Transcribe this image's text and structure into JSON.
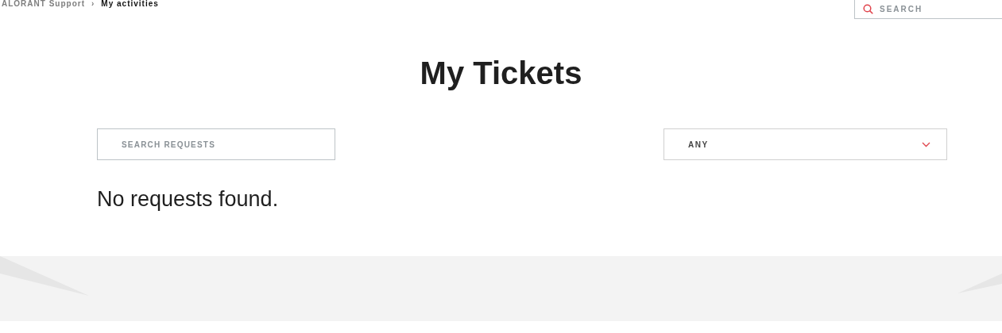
{
  "breadcrumb": [
    {
      "label": "ALORANT Support",
      "current": false
    },
    {
      "label": "My activities",
      "current": true
    }
  ],
  "breadcrumb_separator": "›",
  "header_search": {
    "placeholder": "SEARCH"
  },
  "title": "My Tickets",
  "request_search": {
    "placeholder": "SEARCH REQUESTS"
  },
  "status_filter": {
    "value": "ANY"
  },
  "empty_message": "No requests found."
}
